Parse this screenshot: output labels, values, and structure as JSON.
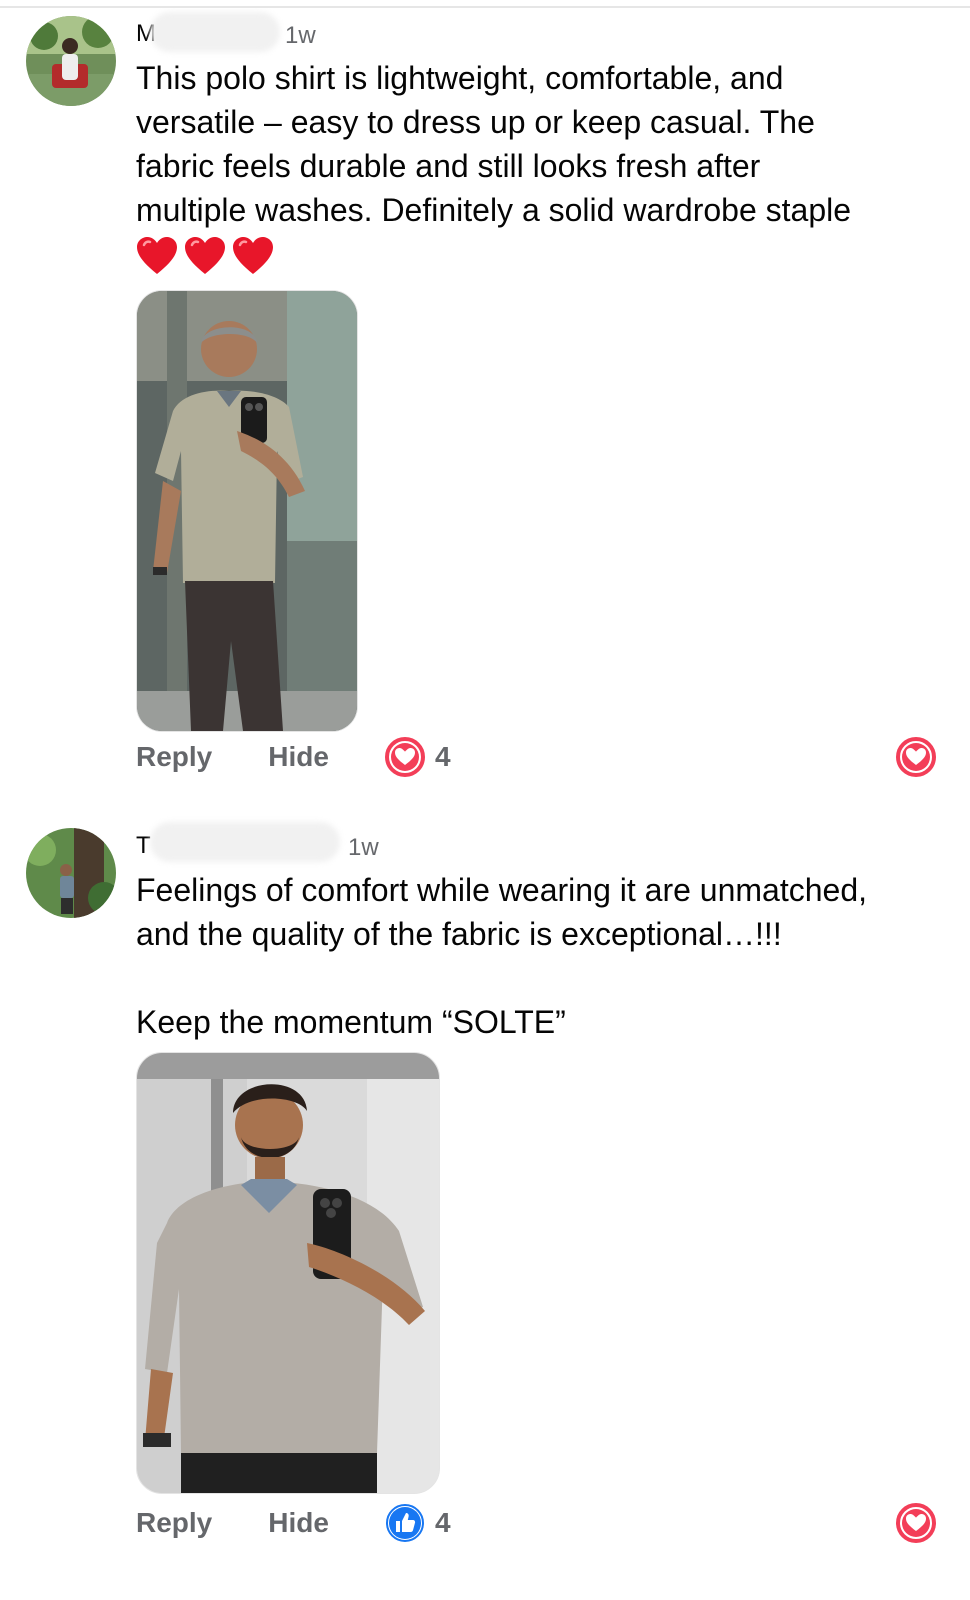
{
  "comments": [
    {
      "author": "M",
      "time": "1w",
      "text_lines": [
        "This polo shirt is lightweight, comfortable, and",
        "versatile – easy to dress up or keep casual. The",
        "fabric feels durable and still looks fresh after",
        "multiple washes. Definitely a solid wardrobe staple"
      ],
      "emoji": "heart-emoji",
      "reply_label": "Reply",
      "hide_label": "Hide",
      "reaction_icon": "love-reaction-icon",
      "reaction_count": "4",
      "reaction_color": "#f33e58"
    },
    {
      "author": "T",
      "time": "1w",
      "text_lines": [
        "Feelings of comfort while wearing it are unmatched,",
        "and the quality of the fabric is exceptional…!!!",
        "",
        "Keep the momentum “SOLTE”"
      ],
      "reply_label": "Reply",
      "hide_label": "Hide",
      "reaction_icon": "like-reaction-icon",
      "reaction_count": "4",
      "reaction_color": "#1877f2"
    }
  ],
  "colors": {
    "secondary_text": "#65676b",
    "heart": "#f33e58",
    "like_blue": "#1877f2"
  }
}
